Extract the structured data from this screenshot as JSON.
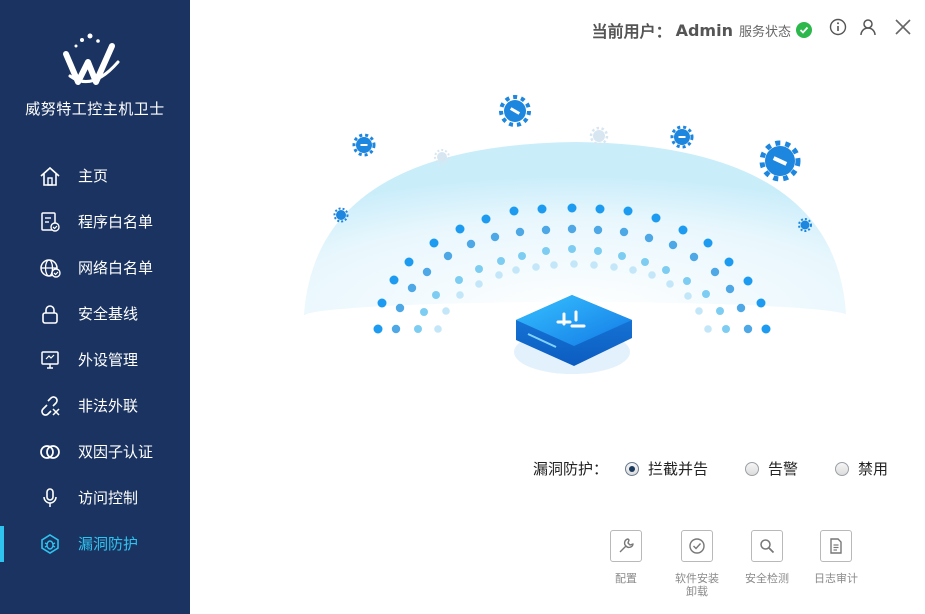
{
  "app": {
    "name": "威努特工控主机卫士"
  },
  "sidebar": {
    "items": [
      {
        "label": "主页",
        "icon": "home-icon"
      },
      {
        "label": "程序白名单",
        "icon": "program-whitelist-icon"
      },
      {
        "label": "网络白名单",
        "icon": "network-globe-icon"
      },
      {
        "label": "安全基线",
        "icon": "lock-icon"
      },
      {
        "label": "外设管理",
        "icon": "monitor-icon"
      },
      {
        "label": "非法外联",
        "icon": "broken-link-icon"
      },
      {
        "label": "双因子认证",
        "icon": "dual-rings-icon"
      },
      {
        "label": "访问控制",
        "icon": "microphone-icon"
      },
      {
        "label": "漏洞防护",
        "icon": "shield-bug-icon",
        "active": true
      }
    ]
  },
  "header": {
    "user_prefix": "当前用户：",
    "user_name": "Admin",
    "service_status": "服务状态",
    "service_ok_color": "#2db84c"
  },
  "protection": {
    "label": "漏洞防护：",
    "options": [
      {
        "label": "拦截并告",
        "checked": true
      },
      {
        "label": "告警",
        "checked": false
      },
      {
        "label": "禁用",
        "checked": false
      }
    ]
  },
  "tools": [
    {
      "label": "配置",
      "icon": "wrench-icon"
    },
    {
      "label": "软件安装卸载",
      "icon": "check-circle-icon"
    },
    {
      "label": "安全检测",
      "icon": "magnifier-icon"
    },
    {
      "label": "日志审计",
      "icon": "document-icon"
    }
  ],
  "colors": {
    "sidebar_bg": "#1b3360",
    "accent": "#2fc3f0"
  }
}
